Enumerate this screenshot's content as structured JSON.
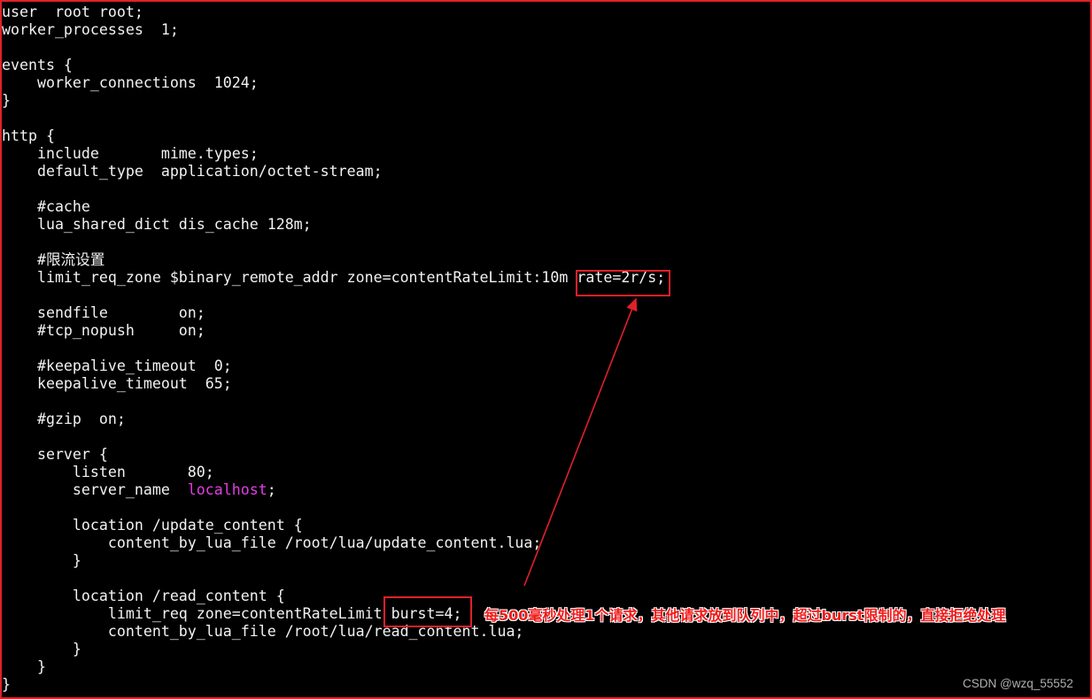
{
  "terminal": {
    "lines": [
      "user  root root;",
      "worker_processes  1;",
      "",
      "events {",
      "    worker_connections  1024;",
      "}",
      "",
      "http {",
      "    include       mime.types;",
      "    default_type  application/octet-stream;",
      "",
      "    #cache",
      "    lua_shared_dict dis_cache 128m;",
      "",
      "    #限流设置",
      "    limit_req_zone $binary_remote_addr zone=contentRateLimit:10m rate=2r/s;",
      "",
      "    sendfile        on;",
      "    #tcp_nopush     on;",
      "",
      "    #keepalive_timeout  0;",
      "    keepalive_timeout  65;",
      "",
      "    #gzip  on;",
      "",
      "    server {",
      "        listen       80;",
      "        server_name  localhost;",
      "",
      "        location /update_content {",
      "            content_by_lua_file /root/lua/update_content.lua;",
      "        }",
      "",
      "        location /read_content {",
      "            limit_req zone=contentRateLimit burst=4;",
      "            content_by_lua_file /root/lua/read_content.lua;",
      "        }",
      "    }",
      "}"
    ],
    "highlight_word": "localhost",
    "highlight_color": "#e23ee2"
  },
  "annotation": {
    "text": "每500毫秒处理1个请求，其他请求放到队列中，超过burst限制的，直接拒绝处理",
    "color": "#f01c1c"
  },
  "watermark": "CSDN @wzq_55552"
}
